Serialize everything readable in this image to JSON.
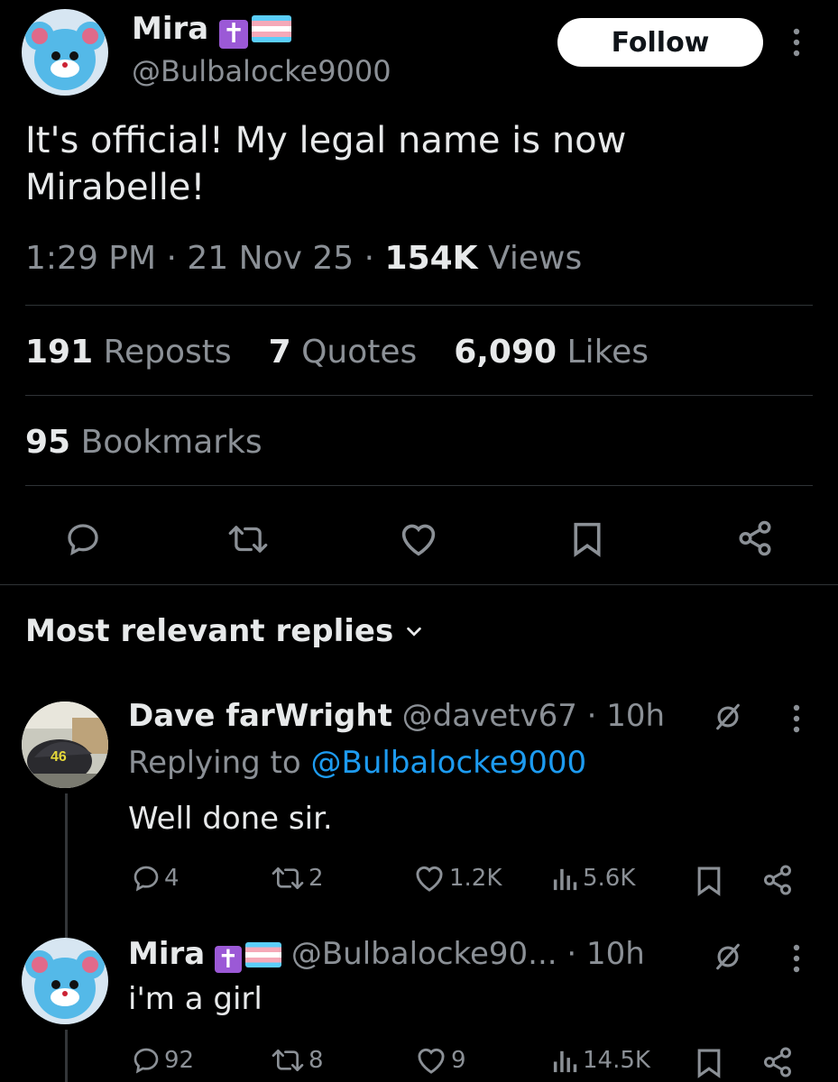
{
  "tweet": {
    "author_name": "Mira",
    "author_handle": "@Bulbalocke9000",
    "follow_label": "Follow",
    "text": "It's official! My legal name is now Mirabelle!",
    "time": "1:29 PM",
    "date": "21 Nov 25",
    "views_count": "154K",
    "views_label": "Views",
    "reposts_count": "191",
    "reposts_label": "Reposts",
    "quotes_count": "7",
    "quotes_label": "Quotes",
    "likes_count": "6,090",
    "likes_label": "Likes",
    "bookmarks_count": "95",
    "bookmarks_label": "Bookmarks"
  },
  "replies_header": "Most relevant replies",
  "replies": [
    {
      "author_name": "Dave farWright",
      "author_handle": "@davetv67",
      "time": "10h",
      "replying_to_label": "Replying to",
      "replying_to_handle": "@Bulbalocke9000",
      "text": "Well done sir.",
      "reply_count": "4",
      "repost_count": "2",
      "like_count": "1.2K",
      "view_count": "5.6K"
    },
    {
      "author_name": "Mira",
      "author_handle": "@Bulbalocke90...",
      "time": "10h",
      "text": "i'm a girl",
      "reply_count": "92",
      "repost_count": "8",
      "like_count": "9",
      "view_count": "14.5K"
    }
  ],
  "icons": {
    "comment": "comment-icon",
    "repost": "repost-icon",
    "like": "heart-icon",
    "bookmark": "bookmark-icon",
    "share": "share-icon",
    "more": "more-vertical-icon",
    "views": "views-icon",
    "grok": "grok-icon",
    "chevron": "chevron-down-icon"
  },
  "colors": {
    "background": "#000000",
    "text": "#e7e9ea",
    "muted": "#8b9096",
    "link": "#1d9bf0",
    "divider": "#2f3336"
  }
}
